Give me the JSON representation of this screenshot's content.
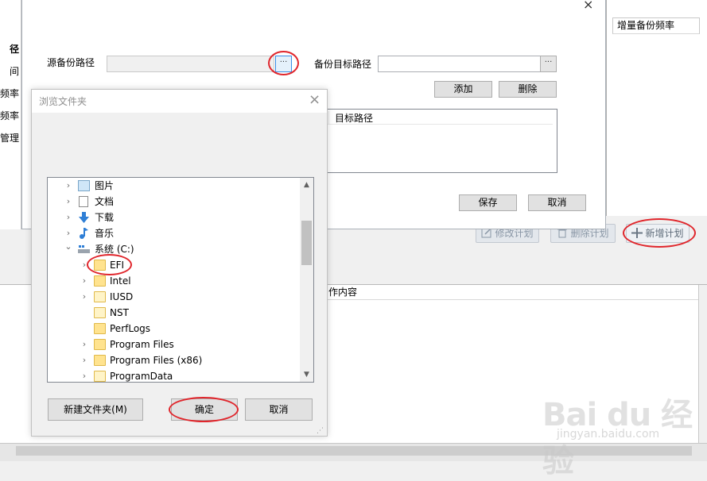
{
  "background": {
    "left_labels": [
      "径",
      "间",
      "频率",
      "频率",
      "管理"
    ],
    "right_column_header": "增量备份频率",
    "buttons": {
      "edit_plan": "修改计划",
      "delete_plan": "删除计划",
      "add_plan": "新增计划"
    },
    "lower_column_header": "作内容"
  },
  "main_dialog": {
    "close_glyph": "×",
    "source_label": "源备份路径",
    "source_value": "",
    "target_label": "备份目标路径",
    "target_value": "",
    "browse_glyph": "···",
    "add_button": "添加",
    "delete_button": "删除",
    "target_list_column": "目标路径",
    "save_button": "保存",
    "cancel_button": "取消"
  },
  "browse_dialog": {
    "title": "浏览文件夹",
    "close_glyph": "×",
    "tree": [
      {
        "label": "图片",
        "icon": "pictures-icon",
        "expander": "›",
        "level": 1
      },
      {
        "label": "文档",
        "icon": "documents-icon",
        "expander": "›",
        "level": 1
      },
      {
        "label": "下载",
        "icon": "downloads-icon",
        "expander": "›",
        "level": 1
      },
      {
        "label": "音乐",
        "icon": "music-icon",
        "expander": "›",
        "level": 1
      },
      {
        "label": "系统 (C:)",
        "icon": "drive-icon",
        "expander": "⌄",
        "level": 1
      },
      {
        "label": "EFI",
        "icon": "folder-icon",
        "expander": "›",
        "level": 2,
        "selected": true
      },
      {
        "label": "Intel",
        "icon": "folder-icon",
        "expander": "›",
        "level": 2
      },
      {
        "label": "IUSD",
        "icon": "folder-icon",
        "expander": "›",
        "level": 2
      },
      {
        "label": "NST",
        "icon": "folder-icon",
        "expander": "",
        "level": 2
      },
      {
        "label": "PerfLogs",
        "icon": "folder-icon",
        "expander": "",
        "level": 2
      },
      {
        "label": "Program Files",
        "icon": "folder-icon",
        "expander": "›",
        "level": 2
      },
      {
        "label": "Program Files (x86)",
        "icon": "folder-icon",
        "expander": "›",
        "level": 2
      },
      {
        "label": "ProgramData",
        "icon": "folder-icon",
        "expander": "›",
        "level": 2
      }
    ],
    "new_folder_button": "新建文件夹(M)",
    "ok_button": "确定",
    "cancel_button": "取消"
  },
  "watermark": {
    "logo": "Bai du 经验",
    "url": "jingyan.baidu.com"
  },
  "colors": {
    "highlight_oval": "#e0262c",
    "folder": "#ffe38f",
    "active_button_border": "#3a8ee6"
  }
}
